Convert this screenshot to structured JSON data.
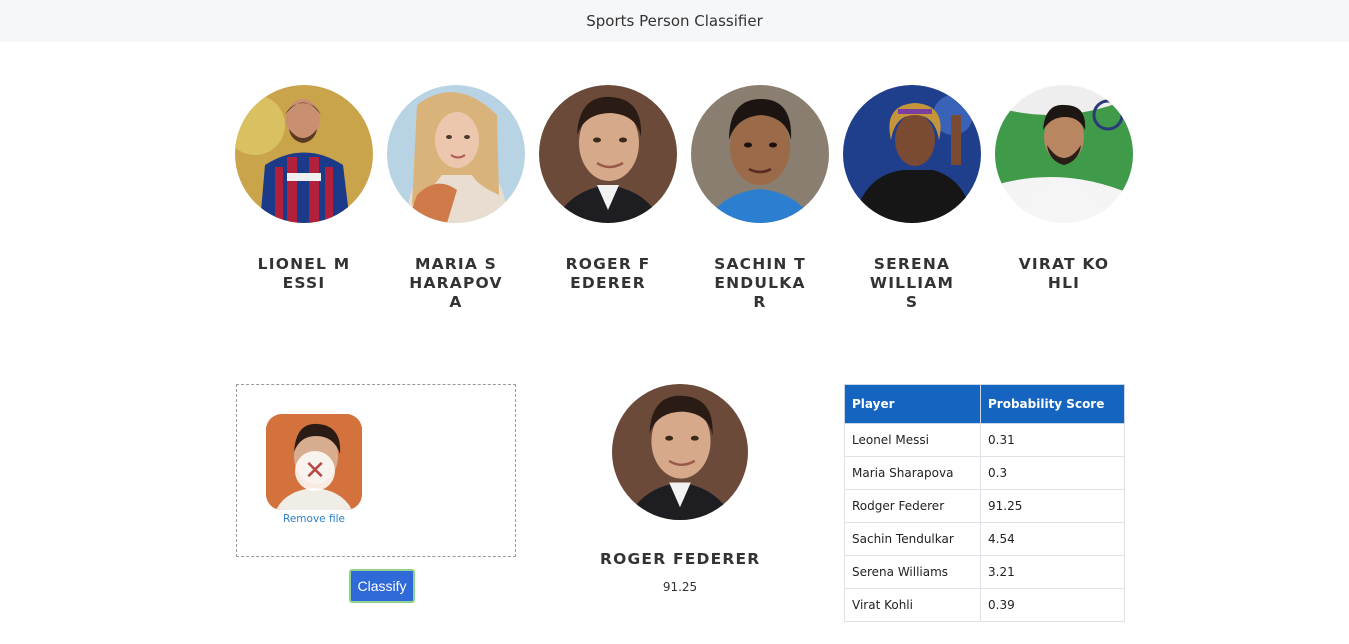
{
  "header": {
    "title": "Sports Person Classifier"
  },
  "players": [
    {
      "name": "Lionel Messi"
    },
    {
      "name": "Maria Sharapova"
    },
    {
      "name": "Roger Federer"
    },
    {
      "name": "Sachin Tendulkar"
    },
    {
      "name": "Serena Williams"
    },
    {
      "name": "Virat Kohli"
    }
  ],
  "upload": {
    "remove_label": "Remove file",
    "remove_icon": "close-icon"
  },
  "classify_button": {
    "label": "Classify"
  },
  "result": {
    "name": "Roger Federer",
    "score": "91.25"
  },
  "table": {
    "headers": [
      "Player",
      "Probability Score"
    ],
    "rows": [
      [
        "Leonel Messi",
        "0.31"
      ],
      [
        "Maria Sharapova",
        "0.3"
      ],
      [
        "Rodger Federer",
        "91.25"
      ],
      [
        "Sachin Tendulkar",
        "4.54"
      ],
      [
        "Serena Williams",
        "3.21"
      ],
      [
        "Virat Kohli",
        "0.39"
      ]
    ]
  },
  "colors": {
    "table_header": "#1565c0",
    "button": "#2f6ad8",
    "navbar": "#f6f7f9"
  }
}
